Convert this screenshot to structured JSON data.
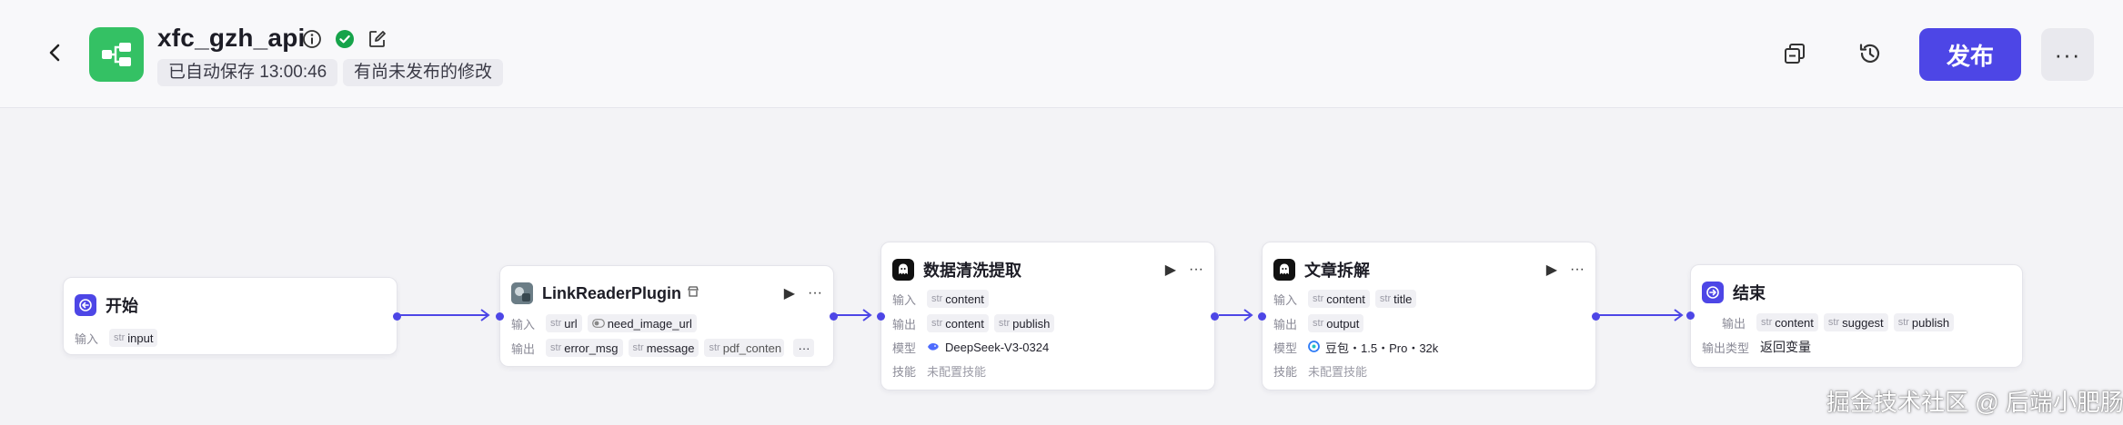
{
  "header": {
    "title": "xfc_gzh_api",
    "autosave": "已自动保存 13:00:46",
    "unpublished": "有尚未发布的修改",
    "publish_label": "发布",
    "more_label": "···",
    "icons": [
      "back-icon",
      "workflow-icon",
      "info-icon",
      "verified-check-icon",
      "edit-icon",
      "copy-icon",
      "history-icon",
      "more-icon"
    ],
    "colors": {
      "accent": "#4d46e6",
      "app_icon": "#34c164",
      "verified": "#16a34a"
    }
  },
  "nodes": {
    "start": {
      "title": "开始",
      "input_label": "输入",
      "inputs": [
        {
          "type": "str",
          "name": "input"
        }
      ]
    },
    "link_reader": {
      "title": "LinkReaderPlugin",
      "input_label": "输入",
      "output_label": "输出",
      "inputs": [
        {
          "type": "str",
          "name": "url"
        },
        {
          "type": "bool",
          "name": "need_image_url"
        }
      ],
      "outputs": [
        {
          "type": "str",
          "name": "error_msg"
        },
        {
          "type": "str",
          "name": "message"
        },
        {
          "type": "str",
          "name": "pdf_conten"
        }
      ],
      "overflow": "···"
    },
    "clean": {
      "title": "数据清洗提取",
      "input_label": "输入",
      "output_label": "输出",
      "model_label": "模型",
      "skill_label": "技能",
      "inputs": [
        {
          "type": "str",
          "name": "content"
        }
      ],
      "outputs": [
        {
          "type": "str",
          "name": "content"
        },
        {
          "type": "str",
          "name": "publish"
        }
      ],
      "model": "DeepSeek-V3-0324",
      "skill": "未配置技能"
    },
    "split": {
      "title": "文章拆解",
      "input_label": "输入",
      "output_label": "输出",
      "model_label": "模型",
      "skill_label": "技能",
      "inputs": [
        {
          "type": "str",
          "name": "content"
        },
        {
          "type": "str",
          "name": "title"
        }
      ],
      "outputs": [
        {
          "type": "str",
          "name": "output"
        }
      ],
      "model": "豆包・1.5・Pro・32k",
      "skill": "未配置技能"
    },
    "end": {
      "title": "结束",
      "output_label": "输出",
      "output_type_label": "输出类型",
      "outputs": [
        {
          "type": "str",
          "name": "content"
        },
        {
          "type": "str",
          "name": "suggest"
        },
        {
          "type": "str",
          "name": "publish"
        }
      ],
      "output_type": "返回变量"
    }
  },
  "watermark": "掘金技术社区 @ 后端小肥肠"
}
